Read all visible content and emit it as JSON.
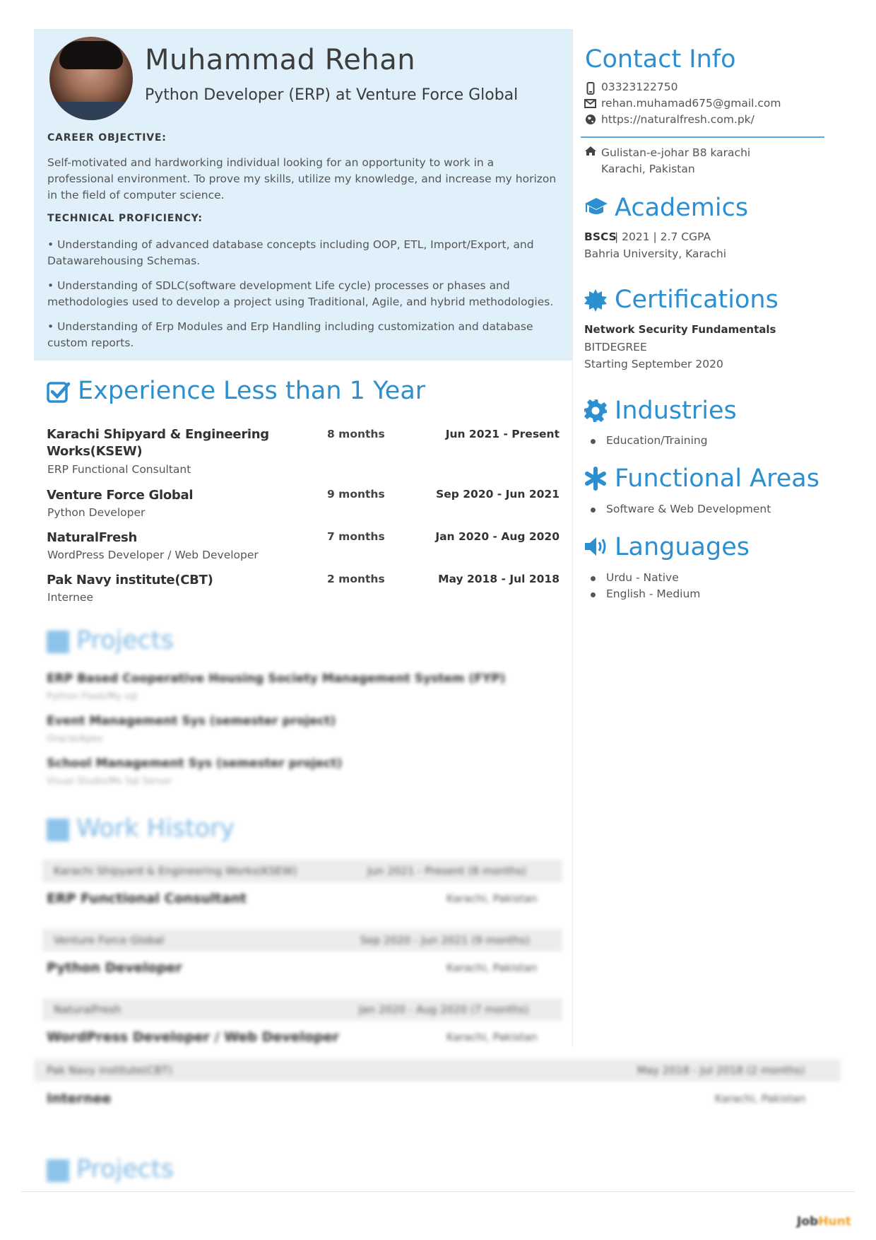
{
  "header": {
    "name": "Muhammad Rehan",
    "headline": "Python Developer (ERP) at Venture Force Global",
    "objective_label": "CAREER OBJECTIVE:",
    "objective_text": "Self-motivated and hardworking individual looking for an opportunity to work in a professional environment. To prove my skills, utilize my knowledge, and increase my horizon in the field of computer science.",
    "technical_label": "TECHNICAL PROFICIENCY:",
    "technical_points": [
      "• Understanding of advanced database concepts including OOP, ETL, Import/Export, and Datawarehousing Schemas.",
      "• Understanding of SDLC(software development Life cycle) processes or phases and methodologies used to develop a project using Traditional, Agile, and hybrid methodologies.",
      "• Understanding of Erp Modules and Erp Handling including customization and database custom reports."
    ]
  },
  "experience": {
    "title": "Experience",
    "total": "Less than 1 Year",
    "items": [
      {
        "company": "Karachi Shipyard & Engineering Works(KSEW)",
        "role": "ERP Functional Consultant",
        "duration": "8 months",
        "range": "Jun 2021 - Present"
      },
      {
        "company": "Venture Force Global",
        "role": "Python Developer",
        "duration": "9 months",
        "range": "Sep 2020 - Jun 2021"
      },
      {
        "company": "NaturalFresh",
        "role": "WordPress Developer / Web Developer",
        "duration": "7 months",
        "range": "Jan 2020 - Aug 2020"
      },
      {
        "company": "Pak Navy institute(CBT)",
        "role": "Internee",
        "duration": "2 months",
        "range": "May 2018 - Jul 2018"
      }
    ]
  },
  "projects": {
    "title": "Projects",
    "items": [
      {
        "name": "ERP Based Cooperative Housing Society Management System (FYP)",
        "tech": "Python Flask/My sql"
      },
      {
        "name": "Event Management Sys (semester project)",
        "tech": "Oracle/Apex"
      },
      {
        "name": "School Management Sys (semester project)",
        "tech": "Visual Studio/Ms Sql Server"
      }
    ]
  },
  "work_history": {
    "title": "Work History",
    "items": [
      {
        "company": "Karachi Shipyard & Engineering Works(KSEW)",
        "period": "Jun 2021 - Present   (8 months)",
        "role": "ERP Functional Consultant",
        "location": "Karachi, Pakistan"
      },
      {
        "company": "Venture Force Global",
        "period": "Sep 2020 - Jun 2021   (9 months)",
        "role": "Python Developer",
        "location": "Karachi, Pakistan"
      },
      {
        "company": "NaturalFresh",
        "period": "Jan 2020 - Aug 2020   (7 months)",
        "role": "WordPress Developer / Web Developer",
        "location": "Karachi, Pakistan"
      },
      {
        "company": "Pak Navy institute(CBT)",
        "period": "May 2018 - Jul 2018   (2 months)",
        "role": "Internee",
        "location": "Karachi, Pakistan"
      }
    ]
  },
  "projects_repeat_title": "Projects",
  "contact": {
    "title": "Contact Info",
    "phone": "03323122750",
    "email": "rehan.muhamad675@gmail.com",
    "website": "https://naturalfresh.com.pk/",
    "address_line1": "Gulistan-e-johar B8 karachi",
    "address_line2": "Karachi, Pakistan"
  },
  "academics": {
    "title": "Academics",
    "degree": "BSCS",
    "details": " | 2021 | 2.7 CGPA",
    "institution": "Bahria University, Karachi"
  },
  "certifications": {
    "title": "Certifications",
    "name": "Network Security Fundamentals",
    "issuer": "BITDEGREE",
    "start": "Starting September 2020"
  },
  "industries": {
    "title": "Industries",
    "items": [
      "Education/Training"
    ]
  },
  "functional_areas": {
    "title": "Functional Areas",
    "items": [
      "Software & Web Development"
    ]
  },
  "languages": {
    "title": "Languages",
    "items": [
      "Urdu - Native",
      "English - Medium"
    ]
  },
  "footer": {
    "logo_main": "Job",
    "logo_accent": "Hunt"
  },
  "colors": {
    "accent": "#2b8fd0",
    "header_bg": "#dff0fb"
  },
  "icons": [
    "phone-icon",
    "email-icon",
    "globe-icon",
    "home-icon",
    "graduation-cap-icon",
    "certificate-icon",
    "gear-icon",
    "asterisk-icon",
    "speaker-icon",
    "checkbox-icon",
    "list-icon"
  ]
}
